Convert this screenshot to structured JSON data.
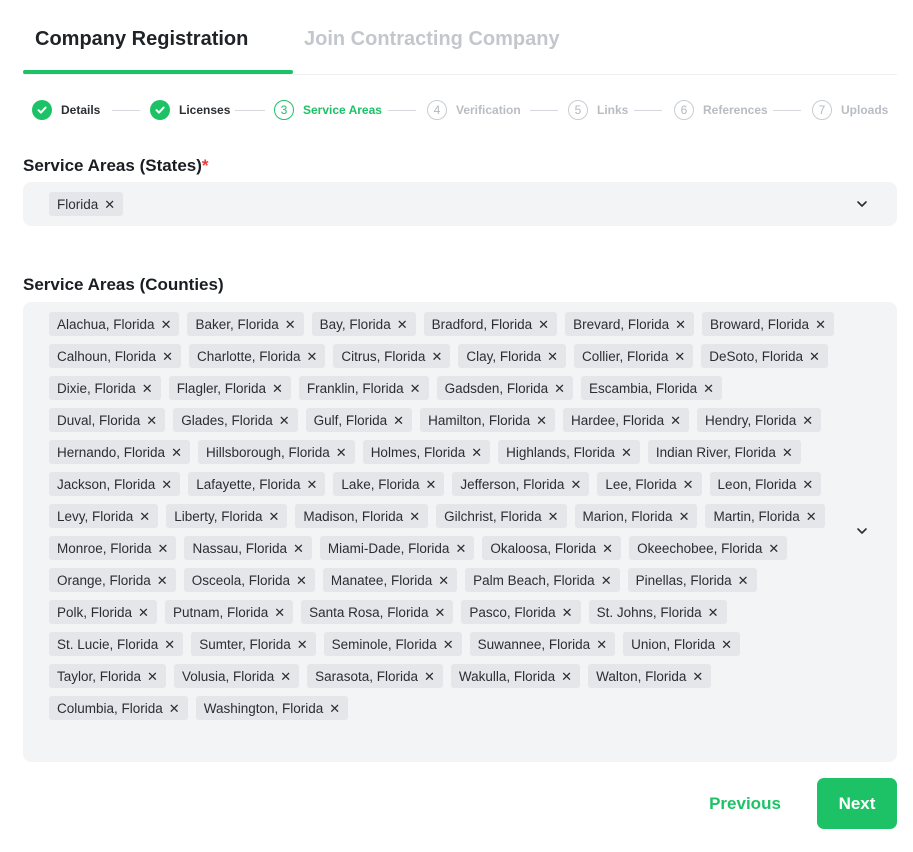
{
  "tabs": [
    {
      "label": "Company Registration",
      "active": true
    },
    {
      "label": "Join Contracting Company",
      "active": false
    }
  ],
  "stepper": {
    "steps": [
      {
        "number": "1",
        "label": "Details",
        "status": "done"
      },
      {
        "number": "2",
        "label": "Licenses",
        "status": "done"
      },
      {
        "number": "3",
        "label": "Service Areas",
        "status": "current"
      },
      {
        "number": "4",
        "label": "Verification",
        "status": "future"
      },
      {
        "number": "5",
        "label": "Links",
        "status": "future"
      },
      {
        "number": "6",
        "label": "References",
        "status": "future"
      },
      {
        "number": "7",
        "label": "Uploads",
        "status": "future"
      }
    ]
  },
  "states_field": {
    "label": "Service Areas (States)",
    "required_mark": "*",
    "selected": [
      "Florida"
    ]
  },
  "counties_field": {
    "label": "Service Areas (Counties)",
    "selected": [
      "Alachua, Florida",
      "Baker, Florida",
      "Bay, Florida",
      "Bradford, Florida",
      "Brevard, Florida",
      "Broward, Florida",
      "Calhoun, Florida",
      "Charlotte, Florida",
      "Citrus, Florida",
      "Clay, Florida",
      "Collier, Florida",
      "DeSoto, Florida",
      "Dixie, Florida",
      "Flagler, Florida",
      "Franklin, Florida",
      "Gadsden, Florida",
      "Escambia, Florida",
      "Duval, Florida",
      "Glades, Florida",
      "Gulf, Florida",
      "Hamilton, Florida",
      "Hardee, Florida",
      "Hendry, Florida",
      "Hernando, Florida",
      "Hillsborough, Florida",
      "Holmes, Florida",
      "Highlands, Florida",
      "Indian River, Florida",
      "Jackson, Florida",
      "Lafayette, Florida",
      "Lake, Florida",
      "Jefferson, Florida",
      "Lee, Florida",
      "Leon, Florida",
      "Levy, Florida",
      "Liberty, Florida",
      "Madison, Florida",
      "Gilchrist, Florida",
      "Marion, Florida",
      "Martin, Florida",
      "Monroe, Florida",
      "Nassau, Florida",
      "Miami-Dade, Florida",
      "Okaloosa, Florida",
      "Okeechobee, Florida",
      "Orange, Florida",
      "Osceola, Florida",
      "Manatee, Florida",
      "Palm Beach, Florida",
      "Pinellas, Florida",
      "Polk, Florida",
      "Putnam, Florida",
      "Santa Rosa, Florida",
      "Pasco, Florida",
      "St. Johns, Florida",
      "St. Lucie, Florida",
      "Sumter, Florida",
      "Seminole, Florida",
      "Suwannee, Florida",
      "Union, Florida",
      "Taylor, Florida",
      "Volusia, Florida",
      "Sarasota, Florida",
      "Wakulla, Florida",
      "Walton, Florida",
      "Columbia, Florida",
      "Washington, Florida"
    ]
  },
  "chip_remove_glyph": "✕",
  "icons": {
    "check": "check-icon",
    "dropdown": "chevron-down-icon",
    "remove": "close-icon"
  },
  "colors": {
    "accent": "#1ec266",
    "required": "#e53b3b",
    "field_bg": "#f3f4f6",
    "chip_bg": "#e4e6e9"
  },
  "buttons": {
    "previous": "Previous",
    "next": "Next"
  }
}
